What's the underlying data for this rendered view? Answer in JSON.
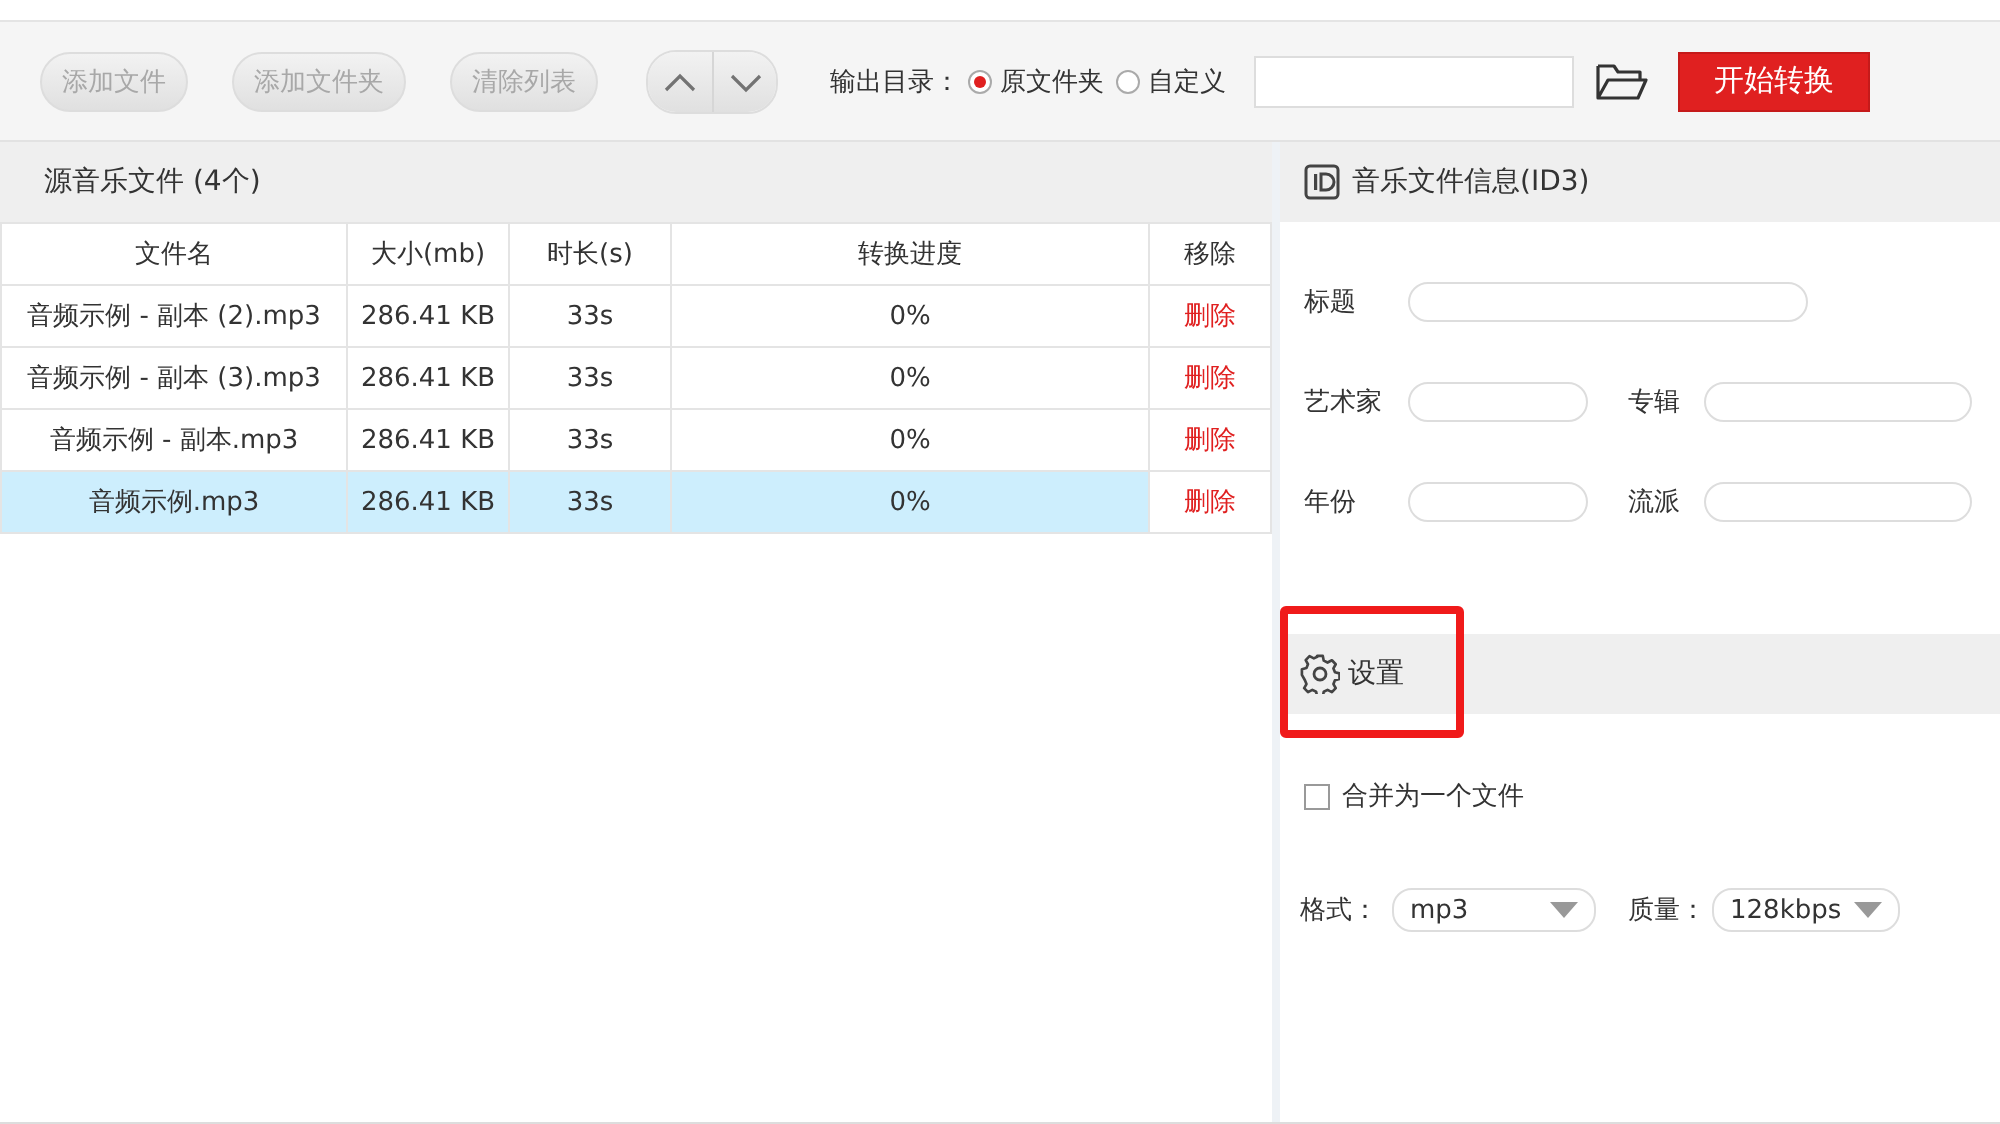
{
  "toolbar": {
    "buttons": [
      {
        "label": "添加文件",
        "disabled": true
      },
      {
        "label": "添加文件夹",
        "disabled": true
      },
      {
        "label": "清除列表",
        "disabled": true
      }
    ],
    "move_buttons": [
      {
        "kind": "up",
        "disabled": true
      },
      {
        "kind": "down",
        "disabled": true
      }
    ],
    "output_label": "输出目录：",
    "output_options": [
      {
        "label": "原文件夹",
        "selected": true
      },
      {
        "label": "自定义",
        "selected": false
      }
    ],
    "start_button": "开始转换"
  },
  "source_panel": {
    "title": "源音乐文件 (4个)",
    "table": {
      "columns": [
        "文件名",
        "大小(mb)",
        "时长(s)",
        "转换进度",
        "移除"
      ],
      "rows": [
        {
          "name": "音频示例 - 副本 (2).mp3",
          "size": "286.41 KB",
          "duration": "33s",
          "progress": "0%",
          "remove": "删除",
          "selected": false
        },
        {
          "name": "音频示例 - 副本 (3).mp3",
          "size": "286.41 KB",
          "duration": "33s",
          "progress": "0%",
          "remove": "删除",
          "selected": false
        },
        {
          "name": "音频示例 - 副本.mp3",
          "size": "286.41 KB",
          "duration": "33s",
          "progress": "0%",
          "remove": "删除",
          "selected": false
        },
        {
          "name": "音频示例.mp3",
          "size": "286.41 KB",
          "duration": "33s",
          "progress": "0%",
          "remove": "删除",
          "selected": true
        }
      ]
    }
  },
  "info_panel": {
    "title": "音乐文件信息(ID3)",
    "fields": [
      {
        "label": "标题",
        "kind": "wide"
      },
      {
        "label": "艺术家",
        "kind": "half"
      },
      {
        "label": "专辑",
        "kind": "half"
      },
      {
        "label": "年份",
        "kind": "half"
      },
      {
        "label": "流派",
        "kind": "half"
      }
    ]
  },
  "settings_panel": {
    "title": "设置",
    "highlighted": true,
    "merge": {
      "label": "合并为一个文件",
      "checked": false
    },
    "format": {
      "label": "格式：",
      "value": "mp3"
    },
    "quality": {
      "label": "质量：",
      "value": "128kbps"
    }
  }
}
